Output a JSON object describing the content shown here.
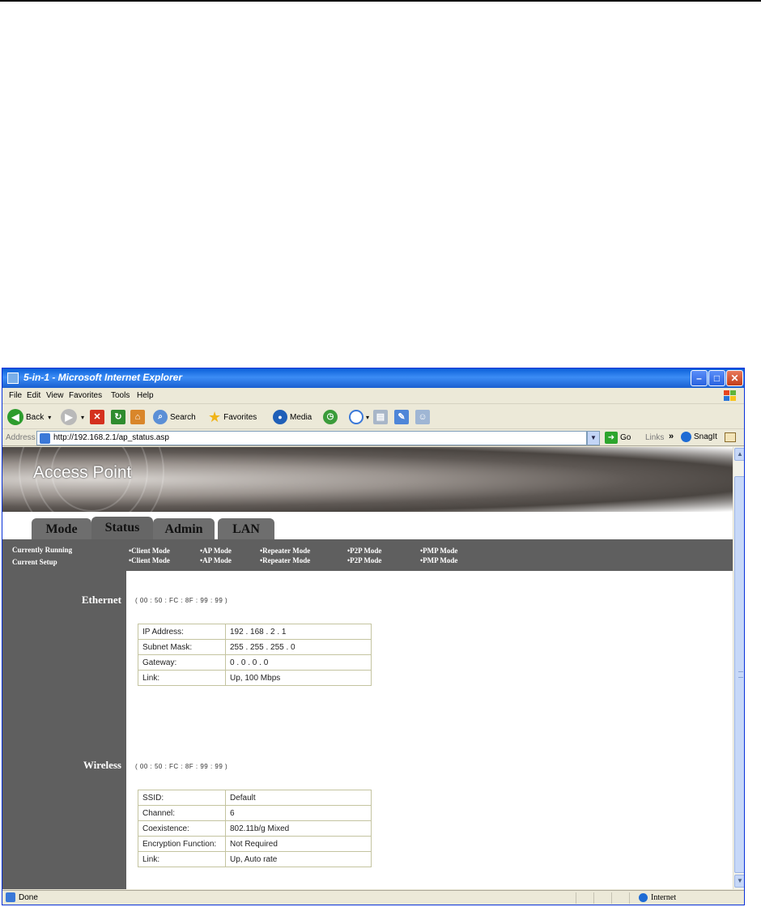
{
  "window": {
    "title": "5-in-1 - Microsoft Internet Explorer",
    "minimize_glyph": "–",
    "maximize_glyph": "□",
    "close_glyph": "✕"
  },
  "menu": [
    "File",
    "Edit",
    "View",
    "Favorites",
    "Tools",
    "Help"
  ],
  "toolbar": {
    "back": "Back",
    "search": "Search",
    "favorites": "Favorites",
    "media": "Media"
  },
  "address": {
    "label": "Address",
    "url": "http://192.168.2.1/ap_status.asp",
    "go": "Go",
    "links": "Links",
    "snagit": "SnagIt"
  },
  "banner": {
    "title": "Access Point"
  },
  "tabs": [
    "Mode",
    "Status",
    "Admin",
    "LAN"
  ],
  "active_tab": "Status",
  "strip": {
    "row1_label": "Currently Running",
    "row2_label": "Current Setup",
    "modes": [
      "•Client Mode",
      "•AP Mode",
      "•Repeater Mode",
      "•P2P Mode",
      "•PMP Mode"
    ]
  },
  "ethernet": {
    "label": "Ethernet",
    "mac": "( 00 : 50 : FC : 8F : 99 : 99 )",
    "rows": [
      {
        "key": "IP Address:",
        "value": "192 . 168 . 2 . 1"
      },
      {
        "key": "Subnet Mask:",
        "value": "255 . 255 . 255 . 0"
      },
      {
        "key": "Gateway:",
        "value": "0 . 0 . 0 . 0"
      },
      {
        "key": "Link:",
        "value": "Up, 100 Mbps"
      }
    ]
  },
  "wireless": {
    "label": "Wireless",
    "mac": "( 00 : 50 : FC : 8F : 99 : 99 )",
    "rows": [
      {
        "key": "SSID:",
        "value": "Default"
      },
      {
        "key": "Channel:",
        "value": "6"
      },
      {
        "key": "Coexistence:",
        "value": "802.11b/g Mixed"
      },
      {
        "key": "Encryption Function:",
        "value": "Not Required"
      },
      {
        "key": "Link:",
        "value": "Up,  Auto rate"
      }
    ]
  },
  "statusbar": {
    "left": "Done",
    "zone": "Internet"
  }
}
